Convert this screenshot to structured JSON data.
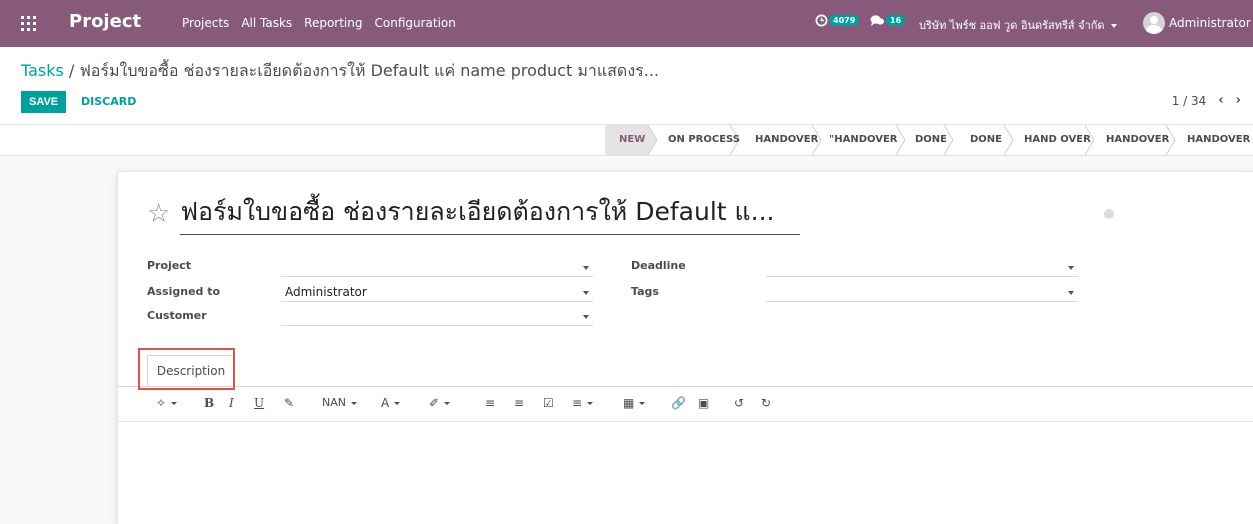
{
  "navbar": {
    "brand": "Project",
    "menu": [
      "Projects",
      "All Tasks",
      "Reporting",
      "Configuration"
    ],
    "activity_count": "4079",
    "message_count": "16",
    "company": "บริษัท ไพร์ช ออฟ วูด อินดรัสทรีส์ จำกัด",
    "user": "Administrator"
  },
  "breadcrumb": {
    "parent": "Tasks",
    "separator": " / ",
    "current": "ฟอร์มใบขอซื้อ ช่องรายละเอียดต้องการให้ Default แค่ name product มาแสดงร..."
  },
  "buttons": {
    "save": "SAVE",
    "discard": "DISCARD"
  },
  "pager": {
    "value": "1 / 34"
  },
  "stages": [
    {
      "label": "NEW",
      "active": true
    },
    {
      "label": "ON PROCESS",
      "active": false
    },
    {
      "label": "HANDOVER",
      "active": false
    },
    {
      "label": "\"HANDOVER",
      "active": false
    },
    {
      "label": "DONE",
      "active": false
    },
    {
      "label": "DONE",
      "active": false
    },
    {
      "label": "HAND OVER",
      "active": false
    },
    {
      "label": "HANDOVER",
      "active": false
    },
    {
      "label": "HANDOVER",
      "active": false
    }
  ],
  "form": {
    "title": "ฟอร์มใบขอซื้อ ช่องรายละเอียดต้องการให้ Default แ...",
    "fields": {
      "project_label": "Project",
      "project_value": "",
      "assigned_label": "Assigned to",
      "assigned_value": "Administrator",
      "customer_label": "Customer",
      "customer_value": "",
      "deadline_label": "Deadline",
      "deadline_value": "",
      "tags_label": "Tags",
      "tags_value": ""
    },
    "tab_description": "Description",
    "toolbar": {
      "font_size": "NAN",
      "text_color_glyph": "A"
    }
  },
  "colors": {
    "navbar": "#875a7b",
    "accent": "#00a09d",
    "highlight": "#d9534f"
  }
}
